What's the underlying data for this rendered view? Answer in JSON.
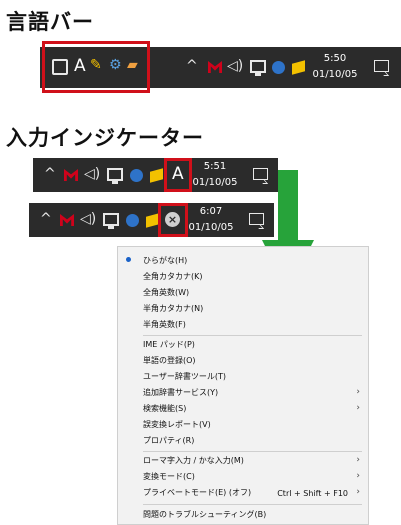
{
  "section1": {
    "title": "言語バー"
  },
  "section2": {
    "title": "入力インジケーター"
  },
  "langbar": {
    "a_label": "A",
    "time": "5:50",
    "date": "01/10/05"
  },
  "tb2": {
    "ime_label": "A",
    "time": "5:51",
    "date": "01/10/05"
  },
  "tb3": {
    "time": "6:07",
    "date": "01/10/05"
  },
  "colors": {
    "arrow": "#27a33a",
    "highlight": "#d0101a",
    "taskbar": "#2b2b2b"
  },
  "menu": {
    "group1": [
      "ひらがな(H)",
      "全角カタカナ(K)",
      "全角英数(W)",
      "半角カタカナ(N)",
      "半角英数(F)"
    ],
    "group2": [
      "IME パッド(P)",
      "単語の登録(O)",
      "ユーザー辞書ツール(T)",
      "追加辞書サービス(Y)",
      "検索機能(S)",
      "誤変換レポート(V)",
      "プロパティ(R)"
    ],
    "group3": [
      "ローマ字入力 / かな入力(M)",
      "変換モード(C)",
      "プライベートモード(E) (オフ)"
    ],
    "group4": [
      "問題のトラブルシューティング(B)"
    ],
    "shortcut": "Ctrl + Shift + F10"
  }
}
